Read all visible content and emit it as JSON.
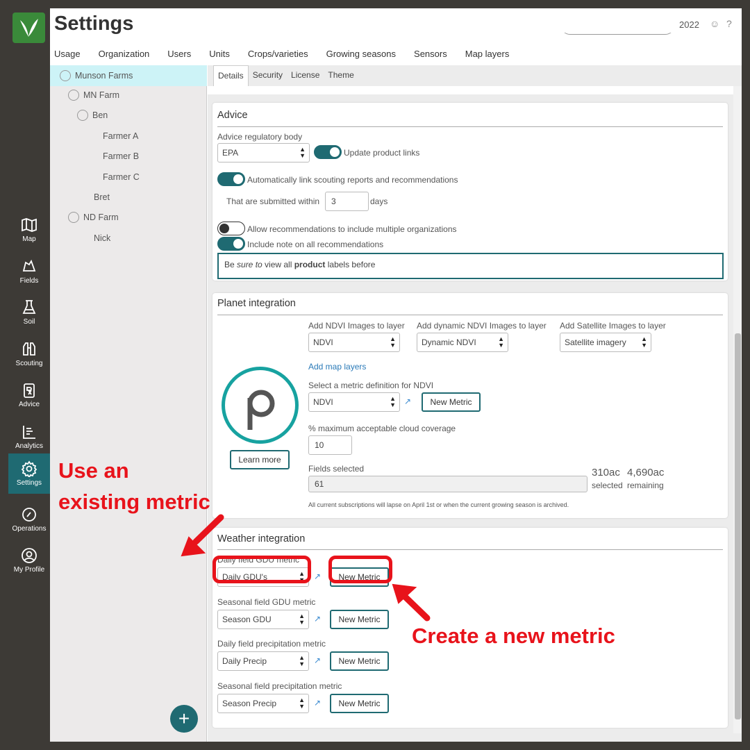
{
  "app": {
    "title": "Settings",
    "year": "2022"
  },
  "header": {
    "tabs": [
      "Usage",
      "Organization",
      "Users",
      "Units",
      "Crops/varieties",
      "Growing seasons",
      "Sensors",
      "Map layers"
    ]
  },
  "leftnav": {
    "items": [
      {
        "label": "Map",
        "icon": "map-icon"
      },
      {
        "label": "Fields",
        "icon": "fields-icon"
      },
      {
        "label": "Soil",
        "icon": "flask-icon"
      },
      {
        "label": "Scouting",
        "icon": "binoculars-icon"
      },
      {
        "label": "Advice",
        "icon": "rx-icon"
      },
      {
        "label": "Analytics",
        "icon": "chart-icon"
      },
      {
        "label": "Settings",
        "icon": "gear-icon"
      },
      {
        "label": "Operations",
        "icon": "gauge-icon"
      },
      {
        "label": "My Profile",
        "icon": "user-icon"
      }
    ]
  },
  "tree": {
    "items": [
      "Munson Farms",
      "MN Farm",
      "Ben",
      "Farmer A",
      "Farmer B",
      "Farmer C",
      "Bret",
      "ND Farm",
      "Nick"
    ]
  },
  "subtabs": [
    "Details",
    "Security",
    "License",
    "Theme"
  ],
  "advice": {
    "title": "Advice",
    "regulatory_label": "Advice regulatory body",
    "regulatory_value": "EPA",
    "update_links_label": "Update product links",
    "auto_link_label": "Automatically link scouting reports and recommendations",
    "submitted_within_label": "That are submitted within",
    "submitted_within_value": "3",
    "days_label": "days",
    "allow_multi_label": "Allow recommendations to include multiple organizations",
    "include_note_label": "Include note on all recommendations",
    "note_prefix": "Be ",
    "note_sure": "sure to",
    "note_mid": " view all ",
    "note_product": "product",
    "note_suffix": " labels before"
  },
  "planet": {
    "title": "Planet integration",
    "ndvi_label": "Add NDVI Images to layer",
    "ndvi_value": "NDVI",
    "dyn_label": "Add dynamic NDVI Images to layer",
    "dyn_value": "Dynamic NDVI",
    "sat_label": "Add Satellite Images to layer",
    "sat_value": "Satellite imagery",
    "add_map_layers": "Add map layers",
    "metric_label": "Select a metric definition for NDVI",
    "metric_value": "NDVI",
    "new_metric": "New Metric",
    "cloud_label": "% maximum acceptable cloud coverage",
    "cloud_value": "10",
    "learn_more": "Learn more",
    "fields_label": "Fields selected",
    "fields_value": "61",
    "selected_ac": "310ac",
    "selected_label": "selected",
    "remaining_ac": "4,690ac",
    "remaining_label": "remaining",
    "note": "All current subscriptions will lapse on April 1st or when the current growing season is archived."
  },
  "weather": {
    "title": "Weather integration",
    "rows": [
      {
        "label": "Daily field GDU metric",
        "value": "Daily GDU's",
        "button": "New Metric"
      },
      {
        "label": "Seasonal field GDU metric",
        "value": "Season GDU",
        "button": "New Metric"
      },
      {
        "label": "Daily field precipitation metric",
        "value": "Daily Precip",
        "button": "New Metric"
      },
      {
        "label": "Seasonal field precipitation metric",
        "value": "Season Precip",
        "button": "New Metric"
      }
    ]
  },
  "annotations": {
    "existing_line1": "Use an",
    "existing_line2": "existing metric",
    "create": "Create a new metric",
    "color": "#e8131b"
  }
}
